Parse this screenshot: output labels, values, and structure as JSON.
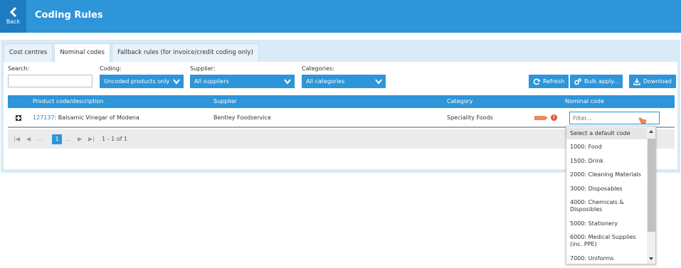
{
  "header": {
    "back_label": "Back",
    "title": "Coding Rules"
  },
  "tabs": [
    {
      "label": "Cost centres",
      "active": false
    },
    {
      "label": "Nominal codes",
      "active": true
    },
    {
      "label": "Fallback rules (for invoice/credit coding only)",
      "active": false
    }
  ],
  "filters": {
    "search_label": "Search:",
    "search_value": "",
    "coding_label": "Coding:",
    "coding_value": "Uncoded products only",
    "supplier_label": "Supplier:",
    "supplier_value": "All suppliers",
    "categories_label": "Categories:",
    "categories_value": "All categories"
  },
  "toolbar": {
    "refresh": "Refresh",
    "bulk_apply": "Bulk apply...",
    "download": "Download"
  },
  "table": {
    "columns": [
      "Product code/description",
      "Supplier",
      "Category",
      "Nominal code"
    ],
    "rows": [
      {
        "code": "127137",
        "description": ": Balsamic Vinegar of Modena",
        "supplier": "Bentley Foodservice",
        "category": "Speciality Foods",
        "nominal_placeholder": "Filter..."
      }
    ]
  },
  "pager": {
    "first": "|◀",
    "prev": "◀",
    "ellipsis": "...",
    "current": "1",
    "next": "▶",
    "last": "▶|",
    "summary": "1 - 1 of 1"
  },
  "dropdown": {
    "items": [
      "Select a default code",
      "1000: Food",
      "1500: Drink",
      "2000: Cleaning Materials",
      "3000: Disposables",
      "4000: Chemicals & Disposibles",
      "5000: Stationery",
      "6000: Medical Supplies (inc. PPE)",
      "7000: Uniforms"
    ]
  },
  "colors": {
    "primary": "#2d95d8",
    "back_bg": "#1d7cc2",
    "panel": "#d9ebf7",
    "link": "#2d7fc1",
    "warning": "#e5533b",
    "arrow": "#f0875a"
  },
  "icons": [
    "chevron-left-icon",
    "chevron-down-icon",
    "refresh-icon",
    "gears-icon",
    "download-icon",
    "plus-square-icon",
    "arrow-right-icon",
    "warning-icon",
    "hand-cursor-icon"
  ]
}
